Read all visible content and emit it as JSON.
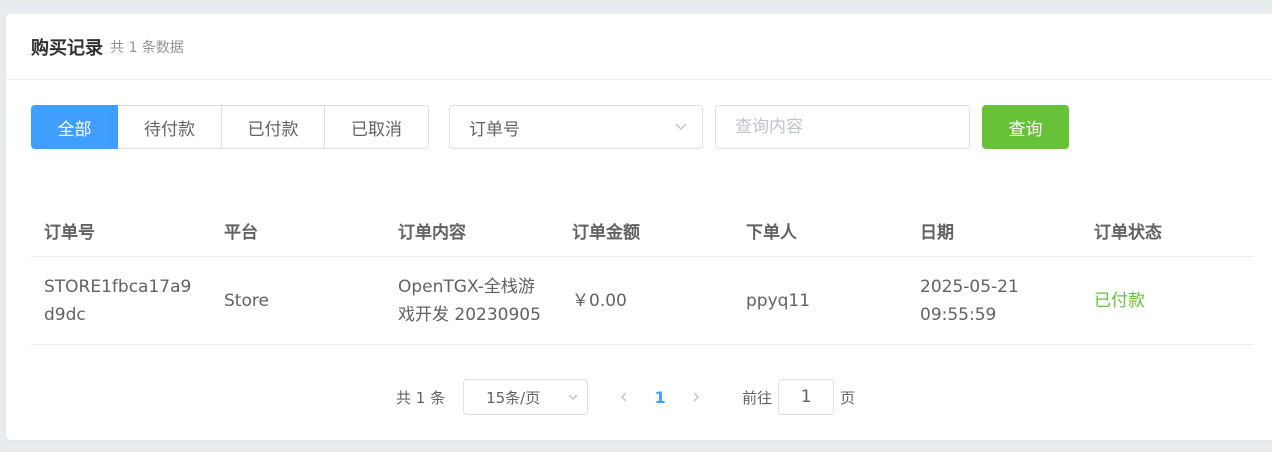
{
  "header": {
    "title": "购买记录",
    "count": "共 1 条数据"
  },
  "filters": {
    "tabs": [
      {
        "label": "全部",
        "active": true
      },
      {
        "label": "待付款",
        "active": false
      },
      {
        "label": "已付款",
        "active": false
      },
      {
        "label": "已取消",
        "active": false
      }
    ],
    "field_select": "订单号",
    "search_placeholder": "查询内容",
    "query_label": "查询"
  },
  "table": {
    "columns": [
      "订单号",
      "平台",
      "订单内容",
      "订单金额",
      "下单人",
      "日期",
      "订单状态"
    ],
    "rows": [
      {
        "order_no": "STORE1fbca17a9d9dc",
        "platform": "Store",
        "content": "OpenTGX-全栈游戏开发 20230905",
        "amount": "￥0.00",
        "buyer": "ppyq11",
        "date": "2025-05-21",
        "time": "09:55:59",
        "status": "已付款"
      }
    ]
  },
  "pagination": {
    "total": "共 1 条",
    "page_size": "15条/页",
    "current_page": "1",
    "goto_label": "前往",
    "goto_value": "1",
    "page_suffix": "页"
  },
  "colors": {
    "primary": "#409eff",
    "success": "#67c23a"
  },
  "icons": {
    "select_arrow": "chevron-down-icon",
    "prev": "chevron-left-icon",
    "next": "chevron-right-icon"
  }
}
